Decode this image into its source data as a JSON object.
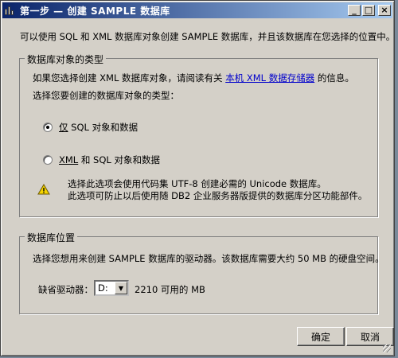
{
  "window": {
    "title": "第一步 — 创建 SAMPLE 数据库",
    "minimize_label": "_",
    "maximize_label": "□",
    "close_label": "×"
  },
  "intro_text": "可以使用 SQL 和 XML 数据库对象创建 SAMPLE 数据库，并且该数据库在您选择的位置中。",
  "object_type_group": {
    "legend": "数据库对象的类型",
    "info_prefix": "如果您选择创建 XML 数据库对象，请阅读有关",
    "info_link": "本机 XML 数据存储器",
    "info_suffix": "的信息。",
    "prompt": "选择您要创建的数据库对象的类型：",
    "options": [
      {
        "label_mnemonic": "仅",
        "label": " SQL 对象和数据",
        "checked": true
      },
      {
        "label_mnemonic": "XML",
        "label": " 和 SQL 对象和数据",
        "checked": false
      }
    ],
    "warning_line1": "选择此选项会使用代码集 UTF-8 创建必需的 Unicode 数据库。",
    "warning_line2": "此选项可防止以后使用随 DB2 企业服务器版提供的数据库分区功能部件。"
  },
  "location_group": {
    "legend": "数据库位置",
    "description": "选择您想用来创建 SAMPLE 数据库的驱动器。该数据库需要大约 50 MB 的硬盘空间。",
    "drive_label": "缺省驱动器：",
    "drive_value": "D:",
    "free_space": "2210 可用的 MB"
  },
  "buttons": {
    "ok": "确定",
    "cancel": "取消"
  },
  "colors": {
    "titlebar_start": "#0a246a",
    "titlebar_end": "#a6caf0",
    "dialog_bg": "#d4d0c8",
    "link": "#0000cc",
    "warning_fill": "#f5d400"
  }
}
